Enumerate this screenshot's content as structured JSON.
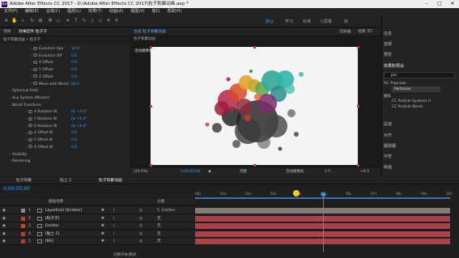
{
  "app_title": "Adobe After Effects CC 2017 - D:\\Adobe After Effects CC 2017\\粒子和聚动画.aep *",
  "menu": [
    "文件(F)",
    "编辑(E)",
    "合成(C)",
    "图层(L)",
    "效果(T)",
    "动画(A)",
    "视图(V)",
    "窗口",
    "帮助(H)"
  ],
  "workspaces": [
    "默认",
    "学习",
    "标准",
    "小屏幕",
    "库"
  ],
  "workspace_active": "默认",
  "search_placeholder": "搜索帮助",
  "effects_panel": {
    "tabs": [
      "项目",
      "效果控件 粒子子"
    ],
    "breadcrumb": "粒子和聚动画 • 粒子子",
    "rows": [
      {
        "label": "Evolution Spe",
        "value": "10.0"
      },
      {
        "label": "Evolution Off",
        "value": "0.0"
      },
      {
        "label": "X Offset",
        "value": "0.0"
      },
      {
        "label": "Y Offset",
        "value": "0.0"
      },
      {
        "label": "Z Offset",
        "value": "0.0"
      },
      {
        "label": "Move with Wind [",
        "value": "80.0"
      },
      {
        "label": "Spherical Field",
        "value": ""
      },
      {
        "label": "Aux System (Master)",
        "value": ""
      },
      {
        "label": "World Transform",
        "value": ""
      },
      {
        "label": "X Rotation W",
        "value": "0x +0.0°"
      },
      {
        "label": "Y Rotation W",
        "value": "0x +0.0°"
      },
      {
        "label": "Z Rotation W",
        "value": "0x +0.0°"
      },
      {
        "label": "X Offset W",
        "value": "0.0"
      },
      {
        "label": "Y Offset W",
        "value": "0.0"
      },
      {
        "label": "Z Offset W",
        "value": "0.0"
      },
      {
        "label": "Visibility",
        "value": ""
      },
      {
        "label": "Rendering",
        "value": ""
      }
    ]
  },
  "viewer": {
    "tab": "合成 粒子和聚动画",
    "render_label": "渲染器",
    "renderer": "经典 3D",
    "sub_tab": "粒子和聚动画",
    "comp_label": "活动摄像机",
    "zoom": "(29.9%)",
    "timecode": "0;00;05;00",
    "resolution": "完整",
    "camera": "活动摄像机",
    "views": "1个...",
    "offset": "+0.0"
  },
  "right_panel": {
    "items": [
      "信息",
      "音频",
      "预览",
      "效果和预设",
      "段落",
      "对齐",
      "跟踪器",
      "字符",
      "绘画",
      "画笔"
    ],
    "search_value": "par",
    "tree": [
      "RG Trapcode",
      "Particular",
      "模拟",
      "CC Particle Systems II",
      "CC Particle World"
    ]
  },
  "timeline": {
    "tabs": [
      "粒子和聚",
      "粘土 2",
      "粒子和聚动画"
    ],
    "timecode": "0;00;05;00",
    "col_header": "图层名称",
    "parent_header": "父级",
    "ruler": [
      "00s",
      "01s",
      "02s",
      "03s",
      "04s",
      "05s",
      "06s",
      "07s",
      "08s",
      "09s",
      "10s"
    ],
    "layers": [
      {
        "num": "1",
        "name": "LayerEmit [Emitter]",
        "parent": "5. Emitter",
        "color": "#8a8a8a"
      },
      {
        "num": "2",
        "name": "[粒子子]",
        "parent": "无",
        "color": "#c0403f"
      },
      {
        "num": "3",
        "name": "Emitter",
        "parent": "无",
        "color": "#b8473c"
      },
      {
        "num": "4",
        "name": "[粘土 2]",
        "parent": "无",
        "color": "#a8443f"
      },
      {
        "num": "5",
        "name": "[BG]",
        "parent": "无",
        "color": "#a6403c"
      }
    ],
    "footer": "切换开关/模式"
  },
  "colors": {
    "accent": "#3e9af5",
    "bar": "#a9424a",
    "bar_top": "#867c77",
    "playhead": "#3d8fe0",
    "marker": "#f0d02a"
  },
  "timeline_progress": {
    "playhead_seconds": 5,
    "duration_seconds": 10
  }
}
